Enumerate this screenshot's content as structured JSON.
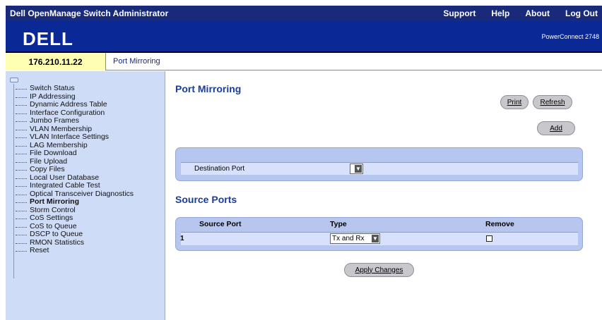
{
  "header": {
    "app_title": "Dell OpenManage Switch Administrator",
    "links": [
      "Support",
      "Help",
      "About",
      "Log Out"
    ]
  },
  "banner": {
    "logo_text": "DELL",
    "model": "PowerConnect 2748"
  },
  "info": {
    "ip_address": "176.210.11.22",
    "breadcrumb": "Port Mirroring"
  },
  "sidebar": {
    "items": [
      {
        "label": "Switch Status"
      },
      {
        "label": "IP Addressing"
      },
      {
        "label": "Dynamic Address Table"
      },
      {
        "label": "Interface Configuration"
      },
      {
        "label": "Jumbo Frames"
      },
      {
        "label": "VLAN Membership"
      },
      {
        "label": "VLAN Interface Settings"
      },
      {
        "label": "LAG Membership"
      },
      {
        "label": "File Download"
      },
      {
        "label": "File Upload"
      },
      {
        "label": "Copy Files"
      },
      {
        "label": "Local User Database"
      },
      {
        "label": "Integrated Cable Test"
      },
      {
        "label": "Optical Transceiver Diagnostics"
      },
      {
        "label": "Port Mirroring"
      },
      {
        "label": "Storm Control"
      },
      {
        "label": "CoS Settings"
      },
      {
        "label": "CoS to Queue"
      },
      {
        "label": "DSCP to Queue"
      },
      {
        "label": "RMON Statistics"
      },
      {
        "label": "Reset"
      }
    ],
    "active_index": 14
  },
  "main": {
    "title": "Port Mirroring",
    "buttons": {
      "print": "Print",
      "refresh": "Refresh",
      "add": "Add",
      "apply": "Apply Changes"
    },
    "destination": {
      "label": "Destination Port",
      "value": ""
    },
    "source_section_title": "Source Ports",
    "source_table": {
      "headers": [
        "Source Port",
        "Type",
        "Remove"
      ],
      "rows": [
        {
          "index": "1",
          "source_port": "",
          "type": "Tx and Rx",
          "remove": false
        }
      ]
    }
  },
  "colors": {
    "topbar": "#1a2a7a",
    "banner": "#0a2896",
    "ip_box": "#ffffb4",
    "sidebar": "#cfdcf7",
    "heading": "#1a3c9c",
    "panel": "#b6c6ee"
  }
}
